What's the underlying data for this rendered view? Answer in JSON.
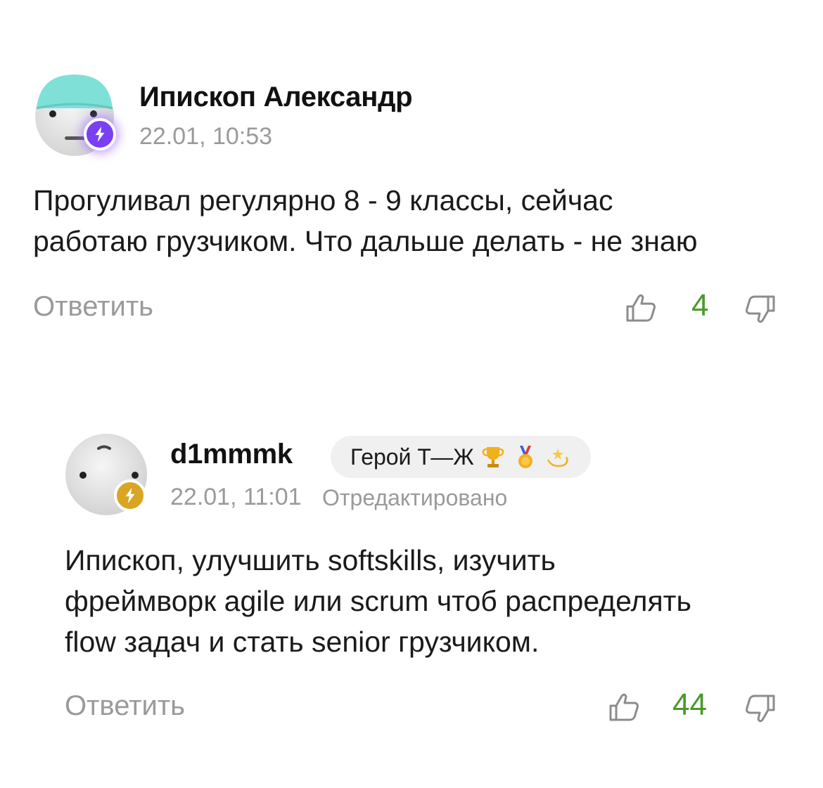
{
  "comments": [
    {
      "author": "Ипископ Александр",
      "timestamp": "22.01, 10:53",
      "text_lines": [
        "Прогуливал регулярно 8 - 9 классы, сейчас",
        "работаю грузчиком. Что дальше делать - не знаю"
      ],
      "reply_label": "Ответить",
      "likes": "4",
      "avatar_icon": "avatar-cap-face-icon",
      "badge_icon": "lightning-badge-icon",
      "badge_color": "#7a3ff2"
    },
    {
      "author": "d1mmmk",
      "hero_badge": "Герой Т—Ж",
      "hero_badge_emojis": [
        "trophy-icon",
        "medal-icon",
        "dizzy-star-icon"
      ],
      "timestamp": "22.01, 11:01",
      "edited_label": "Отредактировано",
      "text_lines": [
        "Ипископ, улучшить softskills, изучить",
        "фреймворк agile или scrum чтоб распределять",
        "flow задач и стать senior грузчиком."
      ],
      "reply_label": "Ответить",
      "likes": "44",
      "avatar_icon": "avatar-face-icon",
      "badge_icon": "lightning-badge-icon",
      "badge_color": "#d9a522"
    }
  ],
  "colors": {
    "like_count": "#4a9a2a",
    "muted_text": "#9a9a9a",
    "cap": "#7fe0d8"
  }
}
